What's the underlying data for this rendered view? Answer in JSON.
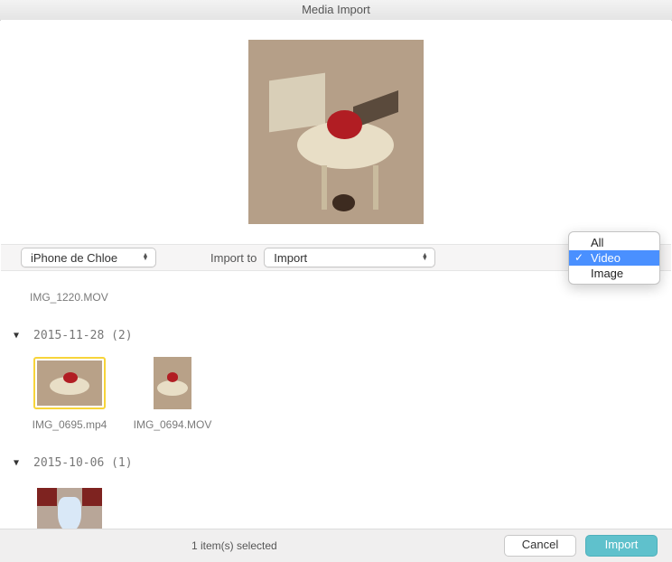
{
  "window": {
    "title": "Media Import"
  },
  "toolbar": {
    "device": "iPhone de Chloe",
    "import_to_label": "Import to",
    "import_to_value": "Import"
  },
  "filter": {
    "options": [
      "All",
      "Video",
      "Image"
    ],
    "selected": "Video"
  },
  "cut_filename": "IMG_1220.MOV",
  "groups": [
    {
      "title": "2015-11-28 (2)",
      "items": [
        {
          "filename": "IMG_0695.mp4",
          "selected": true,
          "shape": "wide"
        },
        {
          "filename": "IMG_0694.MOV",
          "selected": false,
          "shape": "tall"
        }
      ]
    },
    {
      "title": "2015-10-06 (1)",
      "items": [
        {
          "filename": "",
          "selected": false,
          "shape": "wide-person"
        }
      ]
    }
  ],
  "footer": {
    "status": "1 item(s) selected",
    "cancel": "Cancel",
    "import": "Import"
  }
}
